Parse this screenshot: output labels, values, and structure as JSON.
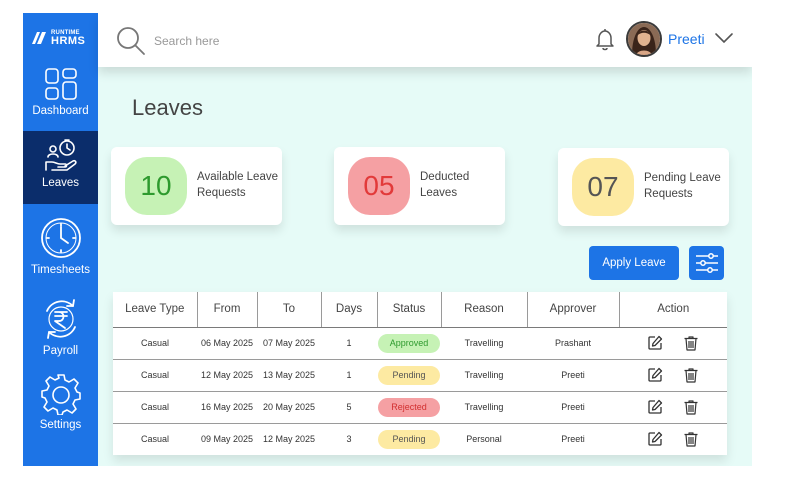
{
  "brand": {
    "line1": "RUNTIME",
    "line2": "HRMS"
  },
  "sidebar": {
    "items": [
      {
        "label": "Dashboard",
        "icon": "grid-icon"
      },
      {
        "label": "Leaves",
        "icon": "leave-hand-icon",
        "active": true
      },
      {
        "label": "Timesheets",
        "icon": "clock-icon"
      },
      {
        "label": "Payroll",
        "icon": "rupee-icon"
      },
      {
        "label": "Settings",
        "icon": "gear-icon"
      }
    ]
  },
  "header": {
    "search_placeholder": "Search here",
    "user_name": "Preeti"
  },
  "page_title": "Leaves",
  "stats": {
    "available": {
      "value": "10",
      "label": "Available Leave Requests"
    },
    "deducted": {
      "value": "05",
      "label": "Deducted Leaves"
    },
    "pending": {
      "value": "07",
      "label": "Pending Leave Requests"
    }
  },
  "apply_label": "Apply Leave",
  "table": {
    "columns": [
      "Leave Type",
      "From",
      "To",
      "Days",
      "Status",
      "Reason",
      "Approver",
      "Action"
    ],
    "rows": [
      {
        "type": "Casual",
        "from": "06 May 2025",
        "to": "07 May 2025",
        "days": "1",
        "status": "Approved",
        "reason": "Travelling",
        "approver": "Prashant"
      },
      {
        "type": "Casual",
        "from": "12 May 2025",
        "to": "13 May 2025",
        "days": "1",
        "status": "Pending",
        "reason": "Travelling",
        "approver": "Preeti"
      },
      {
        "type": "Casual",
        "from": "16 May 2025",
        "to": "20 May 2025",
        "days": "5",
        "status": "Rejected",
        "reason": "Travelling",
        "approver": "Preeti"
      },
      {
        "type": "Casual",
        "from": "09 May 2025",
        "to": "12 May 2025",
        "days": "3",
        "status": "Pending",
        "reason": "Personal",
        "approver": "Preeti"
      }
    ]
  },
  "status_colors": {
    "Approved": {
      "bg": "#c6f2b5",
      "fg": "#2e9a2e"
    },
    "Pending": {
      "bg": "#fdeaa2",
      "fg": "#555555"
    },
    "Rejected": {
      "bg": "#f5a0a3",
      "fg": "#d23030"
    }
  },
  "colors": {
    "primary": "#1d74e6",
    "active_nav": "#0b2d6b",
    "background": "#e6fbf7"
  }
}
